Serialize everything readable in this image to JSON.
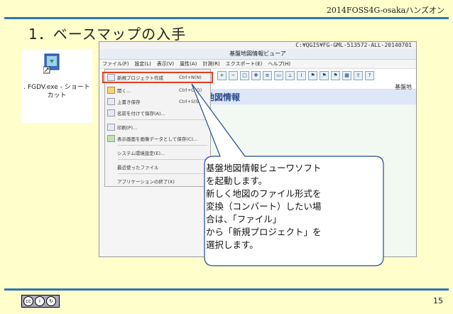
{
  "header": {
    "event": "2014FOSS4G-osakaハンズオン"
  },
  "slide": {
    "title": "1．ベースマップの入手",
    "page": "15"
  },
  "license": {
    "cc": "cc",
    "by": "BY",
    "sa": "SA"
  },
  "shortcut": {
    "label": ". FGDV.exe - ショートカット"
  },
  "app": {
    "path": "C:¥QGIS¥FG-GML-513572-ALL-20140701",
    "title": "基盤地図情報ビューア",
    "menu": [
      "ファイル(F)",
      "設定(L)",
      "表示(V)",
      "属性(A)",
      "計測(R)",
      "エクスポート(E)",
      "ヘルプ(H)"
    ],
    "toolbar_icons": [
      "zoom-in-icon",
      "zoom-out-icon",
      "zoom-box-icon",
      "pan-icon",
      "layers-icon",
      "select-icon",
      "measure-icon",
      "info-icon",
      "flag-icon",
      "flag-icon-2",
      "flag-icon-3",
      "table-icon",
      "export-icon",
      "help-icon"
    ],
    "side_label": "基盤地",
    "banner": "地図情報",
    "file_menu": [
      {
        "label": "新規プロジェクト作成",
        "shortcut": "Ctrl+N(N)"
      },
      {
        "label": "開く...",
        "shortcut": "Ctrl+O(O)"
      },
      {
        "label": "上書き保存",
        "shortcut": "Ctrl+S(S)"
      },
      {
        "label": "名前を付けて保存(A)...",
        "shortcut": ""
      },
      {
        "label": "印刷(P)...",
        "shortcut": ""
      },
      {
        "label": "表示画面を画像データとして保存(C)...",
        "shortcut": ""
      },
      {
        "label": "システム環境設定(E)...",
        "shortcut": ""
      },
      {
        "label": "最近使ったファイル",
        "shortcut": ""
      },
      {
        "label": "アプリケーションの終了(X)",
        "shortcut": ""
      }
    ]
  },
  "callout": {
    "lines": [
      "基盤地図情報ビューワソフト",
      "を起動します。",
      "新しく地図のファイル形式を",
      "変換（コンバート）したい場",
      "合は、「ファイル」",
      "から「新規プロジェクト」を",
      "選択します。"
    ]
  },
  "colors": {
    "accent": "#2e75b6",
    "background": "#ffffcc",
    "highlight": "#e04020"
  }
}
